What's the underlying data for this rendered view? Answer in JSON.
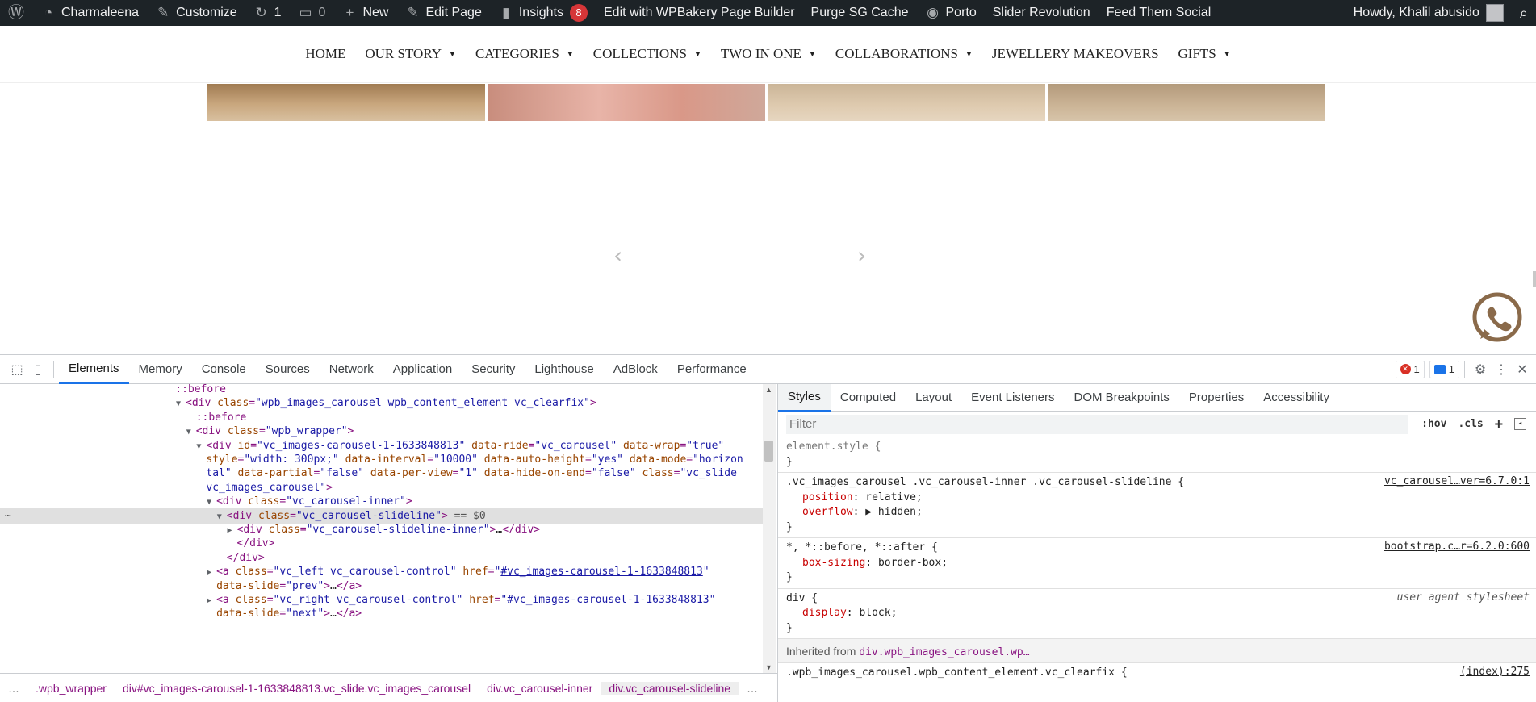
{
  "adminbar": {
    "items": [
      {
        "icon": "wordpress-logo-icon",
        "label": ""
      },
      {
        "icon": "dashboard-icon",
        "label": "Charmaleena"
      },
      {
        "icon": "brush-icon",
        "label": "Customize"
      },
      {
        "icon": "updates-icon",
        "label": "1"
      },
      {
        "icon": "comment-icon",
        "label": "0"
      },
      {
        "icon": "plus-icon",
        "label": "New"
      },
      {
        "icon": "pencil-icon",
        "label": "Edit Page"
      },
      {
        "icon": "bar-chart-icon",
        "label": "Insights",
        "badge": "8"
      },
      {
        "icon": "",
        "label": "Edit with WPBakery Page Builder"
      },
      {
        "icon": "",
        "label": "Purge SG Cache"
      },
      {
        "icon": "porto-icon",
        "label": "Porto"
      },
      {
        "icon": "",
        "label": "Slider Revolution"
      },
      {
        "icon": "",
        "label": "Feed Them Social"
      }
    ],
    "greeting": "Howdy, Khalil abusido"
  },
  "nav": {
    "items": [
      {
        "label": "HOME",
        "dropdown": false
      },
      {
        "label": "OUR STORY",
        "dropdown": true
      },
      {
        "label": "CATEGORIES",
        "dropdown": true
      },
      {
        "label": "COLLECTIONS",
        "dropdown": true
      },
      {
        "label": "TWO IN ONE",
        "dropdown": true
      },
      {
        "label": "COLLABORATIONS",
        "dropdown": true
      },
      {
        "label": "JEWELLERY MAKEOVERS",
        "dropdown": false
      },
      {
        "label": "GIFTS",
        "dropdown": true
      }
    ]
  },
  "carousel": {
    "prev": "‹",
    "next": "›"
  },
  "devtools": {
    "tabs": [
      "Elements",
      "Memory",
      "Console",
      "Sources",
      "Network",
      "Application",
      "Security",
      "Lighthouse",
      "AdBlock",
      "Performance"
    ],
    "active_tab": "Elements",
    "error_count": "1",
    "message_count": "1",
    "elements_lines": [
      {
        "indent": 0,
        "html": "<span class='t-pseudo'>::before</span>"
      },
      {
        "indent": 1,
        "tri": "▼",
        "html": "<span class='t-tag'>&lt;div</span> <span class='t-attr'>class</span>=<span class='t-val'>\"wpb_images_carousel wpb_content_element vc_clearfix\"</span><span class='t-tag'>&gt;</span>"
      },
      {
        "indent": 2,
        "html": "<span class='t-pseudo'>::before</span>"
      },
      {
        "indent": 2,
        "tri": "▼",
        "html": "<span class='t-tag'>&lt;div</span> <span class='t-attr'>class</span>=<span class='t-val'>\"wpb_wrapper\"</span><span class='t-tag'>&gt;</span>"
      },
      {
        "indent": 3,
        "tri": "▼",
        "html": "<span class='t-tag'>&lt;div</span> <span class='t-attr'>id</span>=<span class='t-val'>\"vc_images-carousel-1-1633848813\"</span> <span class='t-attr'>data-ride</span>=<span class='t-val'>\"vc_carousel\"</span> <span class='t-attr'>data-wrap</span>=<span class='t-val'>\"true\"</span>"
      },
      {
        "indent": 3,
        "html": "<span class='t-attr'>style</span>=<span class='t-val'>\"width: 300px;\"</span> <span class='t-attr'>data-interval</span>=<span class='t-val'>\"10000\"</span> <span class='t-attr'>data-auto-height</span>=<span class='t-val'>\"yes\"</span> <span class='t-attr'>data-mode</span>=<span class='t-val'>\"horizon</span>"
      },
      {
        "indent": 3,
        "html": "<span class='t-val'>tal\"</span> <span class='t-attr'>data-partial</span>=<span class='t-val'>\"false\"</span> <span class='t-attr'>data-per-view</span>=<span class='t-val'>\"1\"</span> <span class='t-attr'>data-hide-on-end</span>=<span class='t-val'>\"false\"</span> <span class='t-attr'>class</span>=<span class='t-val'>\"vc_slide</span>"
      },
      {
        "indent": 3,
        "html": "<span class='t-val'>vc_images_carousel\"</span><span class='t-tag'>&gt;</span>"
      },
      {
        "indent": 4,
        "tri": "▼",
        "html": "<span class='t-tag'>&lt;div</span> <span class='t-attr'>class</span>=<span class='t-val'>\"vc_carousel-inner\"</span><span class='t-tag'>&gt;</span>"
      },
      {
        "indent": 5,
        "tri": "▼",
        "sel": true,
        "html": "<span class='t-tag'>&lt;div</span> <span class='t-attr'>class</span>=<span class='t-val'>\"vc_carousel-slideline\"</span><span class='t-tag'>&gt;</span> <span class='t-dim'>== $0</span>"
      },
      {
        "indent": 6,
        "tri": "▶",
        "html": "<span class='t-tag'>&lt;div</span> <span class='t-attr'>class</span>=<span class='t-val'>\"vc_carousel-slideline-inner\"</span><span class='t-tag'>&gt;</span><span class='t-plain'>…</span><span class='t-tag'>&lt;/div&gt;</span>"
      },
      {
        "indent": 6,
        "html": "<span class='t-tag'>&lt;/div&gt;</span>"
      },
      {
        "indent": 5,
        "html": "<span class='t-tag'>&lt;/div&gt;</span>"
      },
      {
        "indent": 4,
        "tri": "▶",
        "html": "<span class='t-tag'>&lt;a</span> <span class='t-attr'>class</span>=<span class='t-val'>\"vc_left vc_carousel-control\"</span> <span class='t-attr'>href</span>=<span class='t-val'>\"</span><span class='t-link'>#vc_images-carousel-1-1633848813</span><span class='t-val'>\"</span>"
      },
      {
        "indent": 4,
        "html": "<span class='t-attr'>data-slide</span>=<span class='t-val'>\"prev\"</span><span class='t-tag'>&gt;</span><span class='t-plain'>…</span><span class='t-tag'>&lt;/a&gt;</span>"
      },
      {
        "indent": 4,
        "tri": "▶",
        "html": "<span class='t-tag'>&lt;a</span> <span class='t-attr'>class</span>=<span class='t-val'>\"vc_right vc_carousel-control\"</span> <span class='t-attr'>href</span>=<span class='t-val'>\"</span><span class='t-link'>#vc_images-carousel-1-1633848813</span><span class='t-val'>\"</span>"
      },
      {
        "indent": 4,
        "html": "<span class='t-attr'>data-slide</span>=<span class='t-val'>\"next\"</span><span class='t-tag'>&gt;</span><span class='t-plain'>…</span><span class='t-tag'>&lt;/a&gt;</span>"
      }
    ],
    "breadcrumbs": [
      ".wpb_wrapper",
      "div#vc_images-carousel-1-1633848813.vc_slide.vc_images_carousel",
      "div.vc_carousel-inner",
      "div.vc_carousel-slideline"
    ],
    "styles_tabs": [
      "Styles",
      "Computed",
      "Layout",
      "Event Listeners",
      "DOM Breakpoints",
      "Properties",
      "Accessibility"
    ],
    "filter_placeholder": "Filter",
    "filter_buttons": [
      ":hov",
      ".cls",
      "+"
    ],
    "rules": [
      {
        "selector": "element.style {",
        "source": "",
        "props": [],
        "close": "}"
      },
      {
        "selector": ".vc_images_carousel .vc_carousel-inner .vc_carousel-slideline {",
        "source": "vc_carousel…ver=6.7.0:1",
        "props": [
          {
            "name": "position",
            "value": "relative;"
          },
          {
            "name": "overflow",
            "value": "▶ hidden;"
          }
        ],
        "close": "}"
      },
      {
        "selector": "*, *::before, *::after {",
        "source": "bootstrap.c…r=6.2.0:600",
        "props": [
          {
            "name": "box-sizing",
            "value": "border-box;"
          }
        ],
        "close": "}"
      },
      {
        "selector": "div {",
        "source": "user agent stylesheet",
        "ua": true,
        "props": [
          {
            "name": "display",
            "value": "block;"
          }
        ],
        "close": "}"
      }
    ],
    "inherited_label": "Inherited from",
    "inherited_link": "div.wpb_images_carousel.wp…",
    "last_rule_selector": ".wpb_images_carousel.wpb_content_element.vc_clearfix {",
    "last_rule_source": "(index):275"
  }
}
